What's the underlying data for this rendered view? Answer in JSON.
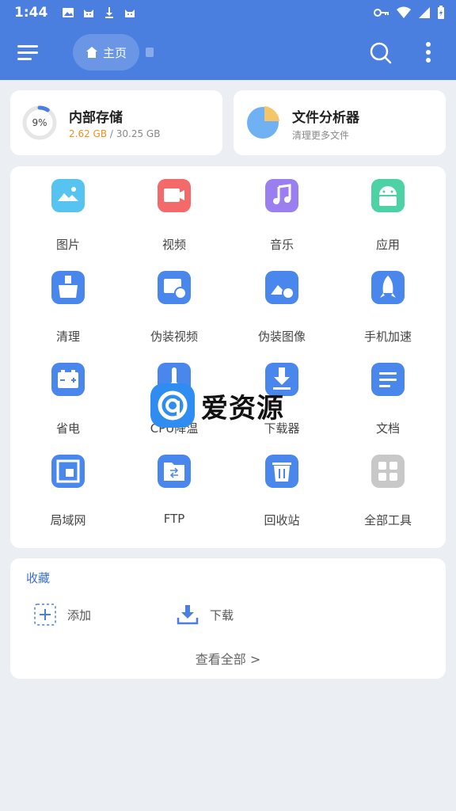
{
  "status_bar": {
    "time": "1:44",
    "left_icons": [
      "image-icon",
      "cat-icon",
      "download-icon",
      "cat-icon"
    ],
    "right_icons": [
      "key-icon",
      "wifi-icon",
      "signal-icon",
      "battery-charging-icon"
    ]
  },
  "app_bar": {
    "home_label": "主页",
    "icons": [
      "menu-icon",
      "home-icon",
      "search-icon",
      "more-vertical-icon"
    ]
  },
  "storage": {
    "title": "内部存储",
    "percent_label": "9%",
    "percent": 9,
    "used": "2.62 GB",
    "separator": " / ",
    "total": "30.25 GB"
  },
  "analyzer": {
    "title": "文件分析器",
    "subtitle": "清理更多文件"
  },
  "tools": [
    {
      "label": "图片",
      "icon": "image-icon",
      "color": "#56c3f0"
    },
    {
      "label": "视频",
      "icon": "video-icon",
      "color": "#f46a6a"
    },
    {
      "label": "音乐",
      "icon": "music-icon",
      "color": "#9b7ef0"
    },
    {
      "label": "应用",
      "icon": "android-icon",
      "color": "#4cd2a4"
    },
    {
      "label": "清理",
      "icon": "broom-icon",
      "color": "#4a87ec"
    },
    {
      "label": "伪装视频",
      "icon": "disguise-video-icon",
      "color": "#4a87ec"
    },
    {
      "label": "伪装图像",
      "icon": "disguise-image-icon",
      "color": "#4a87ec"
    },
    {
      "label": "手机加速",
      "icon": "rocket-icon",
      "color": "#4a87ec"
    },
    {
      "label": "省电",
      "icon": "battery-icon",
      "color": "#4a87ec"
    },
    {
      "label": "CPU降温",
      "icon": "thermometer-icon",
      "color": "#4a87ec"
    },
    {
      "label": "下载器",
      "icon": "downloader-icon",
      "color": "#4a87ec"
    },
    {
      "label": "文档",
      "icon": "document-icon",
      "color": "#4a87ec"
    },
    {
      "label": "局域网",
      "icon": "lan-icon",
      "color": "#4a87ec"
    },
    {
      "label": "FTP",
      "icon": "ftp-folder-icon",
      "color": "#4a87ec"
    },
    {
      "label": "回收站",
      "icon": "trash-icon",
      "color": "#4a87ec"
    },
    {
      "label": "全部工具",
      "icon": "grid-icon",
      "color": "#c8c8c8"
    }
  ],
  "favorites": {
    "title": "收藏",
    "items": [
      {
        "label": "添加",
        "icon": "add-icon"
      },
      {
        "label": "下载",
        "icon": "download-tray-icon"
      }
    ],
    "view_all": "查看全部 >"
  },
  "watermark": {
    "text": "爱资源"
  },
  "colors": {
    "primary": "#4a7fe0",
    "accent_orange": "#f0901e",
    "background": "#ebeef2"
  }
}
